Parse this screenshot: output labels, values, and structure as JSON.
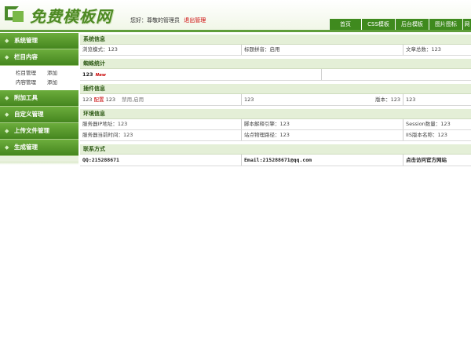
{
  "header": {
    "logo_text": "免费模板网",
    "welcome": "您好：尊敬的管理员",
    "logout": "退出管理",
    "nav": [
      "首页",
      "CSS模板",
      "后台模板",
      "图片图标",
      "网"
    ]
  },
  "sidebar": {
    "menus": [
      {
        "label": "系统管理"
      },
      {
        "label": "栏目内容",
        "items": [
          [
            "栏目管理",
            "添加"
          ],
          [
            "内容管理",
            "添加"
          ]
        ]
      },
      {
        "label": "附加工具"
      },
      {
        "label": "自定义管理"
      },
      {
        "label": "上传文件管理"
      },
      {
        "label": "生成管理"
      }
    ]
  },
  "main": {
    "system": {
      "title": "系统信息",
      "cells": [
        "浏览模式：123",
        "标题拼音：启用",
        "文章总数：123"
      ]
    },
    "stats": {
      "title": "蜘蛛统计",
      "value": "123",
      "new_badge": "New"
    },
    "plugin": {
      "title": "插件信息",
      "value": "123",
      "config": "配置",
      "value2": "123",
      "status": "禁用,启用",
      "mid": "123",
      "version_label": "版本：123",
      "last": "123"
    },
    "env": {
      "title": "环境信息",
      "row1": [
        "服务器IP地址：123",
        "脚本解释引擎：123",
        "Session数量：123"
      ],
      "row2": [
        "服务器当前时间：123",
        "站点物理路径：123",
        "IIS版本名称：123"
      ]
    },
    "contact": {
      "title": "联系方式",
      "qq": "QQ:215288671",
      "email": "Email:215288671@qq.com",
      "link": "点击访问官方网站"
    }
  },
  "colors": {
    "accent": "#4a8a22",
    "header_line": "#5f9d3a",
    "section_bg": "#e4efd7",
    "warn": "#c80000"
  }
}
